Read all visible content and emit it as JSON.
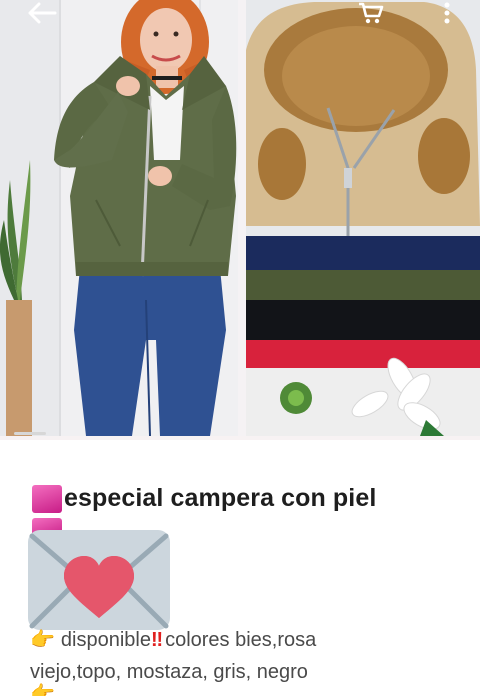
{
  "toolbar": {
    "back_icon": "arrow-left-icon",
    "cart_icon": "shopping-cart-icon",
    "more_icon": "more-vertical-icon"
  },
  "product": {
    "title": "especial campera con piel",
    "availability_word": "disponible",
    "colors_text": "colores bies,rosa",
    "colors_text_2": "viejo,topo, mostaza, gris, negro"
  },
  "colors": {
    "accent_pink": "#d9319e",
    "jacket_olive": "#5c6a45",
    "jacket_beige": "#d4b98d",
    "jeans_blue": "#2e4f8f",
    "heart_red": "#e5566b"
  },
  "icons": {
    "title_square": "pink-square-emoji",
    "hand": "pointing-hand-emoji",
    "bang": "double-exclamation-emoji",
    "envelope": "love-letter-emoji"
  }
}
